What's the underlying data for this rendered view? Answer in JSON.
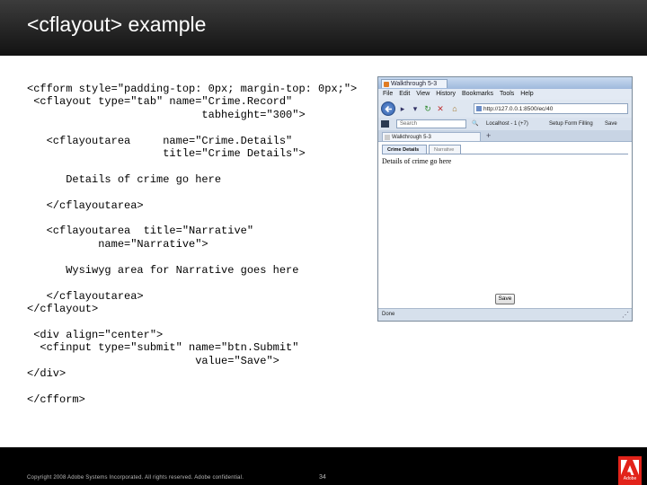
{
  "slide": {
    "title": "<cflayout> example",
    "code": "<cfform style=\"padding-top: 0px; margin-top: 0px;\">\n <cflayout type=\"tab\" name=\"Crime.Record\"\n                           tabheight=\"300\">\n\n   <cflayoutarea     name=\"Crime.Details\"\n                     title=\"Crime Details\">\n\n      Details of crime go here\n\n   </cflayoutarea>\n\n   <cflayoutarea  title=\"Narrative\"\n           name=\"Narrative\">\n\n      Wysiwyg area for Narrative goes here\n\n   </cflayoutarea>\n</cflayout>\n\n <div align=\"center\">\n  <cfinput type=\"submit\" name=\"btn.Submit\"\n                          value=\"Save\">\n</div>\n\n</cfform>",
    "copyright": "Copyright 2008 Adobe Systems Incorporated.  All rights reserved.  Adobe confidential.",
    "page_number": "34",
    "logo_text": "Adobe"
  },
  "browser": {
    "window_title": "Walkthrough 5-3",
    "menu": [
      "File",
      "Edit",
      "View",
      "History",
      "Bookmarks",
      "Tools",
      "Help"
    ],
    "url": "http://127.0.0.1:8500/ec/40",
    "search_placeholder": "Search",
    "localhost_label": "Localhost - 1 (+7)",
    "setup_form_filling": "Setup Form Filling",
    "save_label": "Save",
    "page_tab_title": "Walkthrough 5-3",
    "layout_tabs": [
      "Crime Details",
      "Narrative"
    ],
    "details_text": "Details of crime go here",
    "submit_label": "Save",
    "status": "Done"
  },
  "colors": {
    "header_bg": "#1e1e1e",
    "adobe_red": "#e2231a"
  }
}
